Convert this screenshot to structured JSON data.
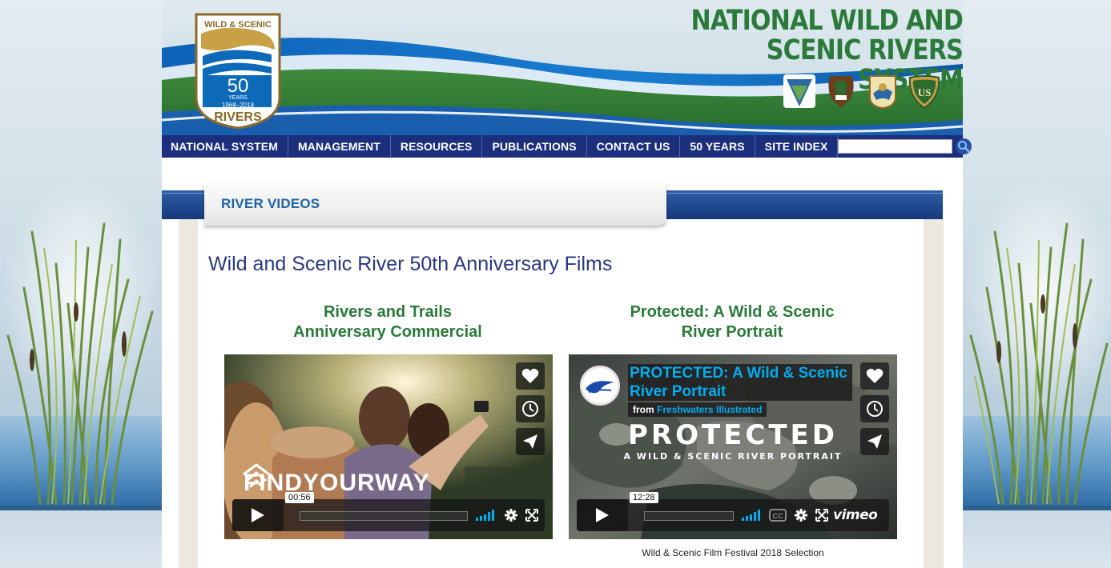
{
  "site": {
    "title_line1": "NATIONAL WILD AND",
    "title_line2": "SCENIC RIVERS SYSTEM",
    "logo": {
      "top_text": "WILD & SCENIC",
      "number": "50",
      "years_label": "YEARS",
      "span": "1968–2018",
      "bottom_text": "RIVERS"
    },
    "agency_icons": [
      "blm-seal-icon",
      "nps-arrowhead-icon",
      "fws-seal-icon",
      "usfs-shield-icon"
    ]
  },
  "nav": {
    "items": [
      {
        "label": "NATIONAL SYSTEM"
      },
      {
        "label": "MANAGEMENT"
      },
      {
        "label": "RESOURCES"
      },
      {
        "label": "PUBLICATIONS"
      },
      {
        "label": "CONTACT US"
      },
      {
        "label": "50 YEARS"
      },
      {
        "label": "SITE INDEX"
      }
    ],
    "search": {
      "value": "",
      "placeholder": ""
    }
  },
  "section": {
    "tab_title": "RIVER VIDEOS",
    "heading": "Wild and Scenic River 50th Anniversary Films"
  },
  "videos": [
    {
      "title_line1": "Rivers and Trails",
      "title_line2": "Anniversary Commercial",
      "overlay_text": "FINDYOURWAY",
      "time": "00:56",
      "caption": ""
    },
    {
      "title_line1": "Protected: A Wild & Scenic",
      "title_line2": "River Portrait",
      "info_title": "PROTECTED: A Wild & Scenic River Portrait",
      "from_label": "from",
      "author": "Freshwaters Illustrated",
      "overlay_line1": "PROTECTED",
      "overlay_line2": "A WILD & SCENIC RIVER PORTRAIT",
      "time": "12:28",
      "cc_label": "CC",
      "vimeo_label": "vimeo",
      "caption": "Wild & Scenic Film Festival 2018 Selection"
    }
  ],
  "colors": {
    "nav_bg": "#1c2f7d",
    "title_green": "#2b7a3a",
    "tab_blue": "#1f63a6",
    "heading_navy": "#2a3880",
    "vimeo_blue": "#00adef"
  }
}
